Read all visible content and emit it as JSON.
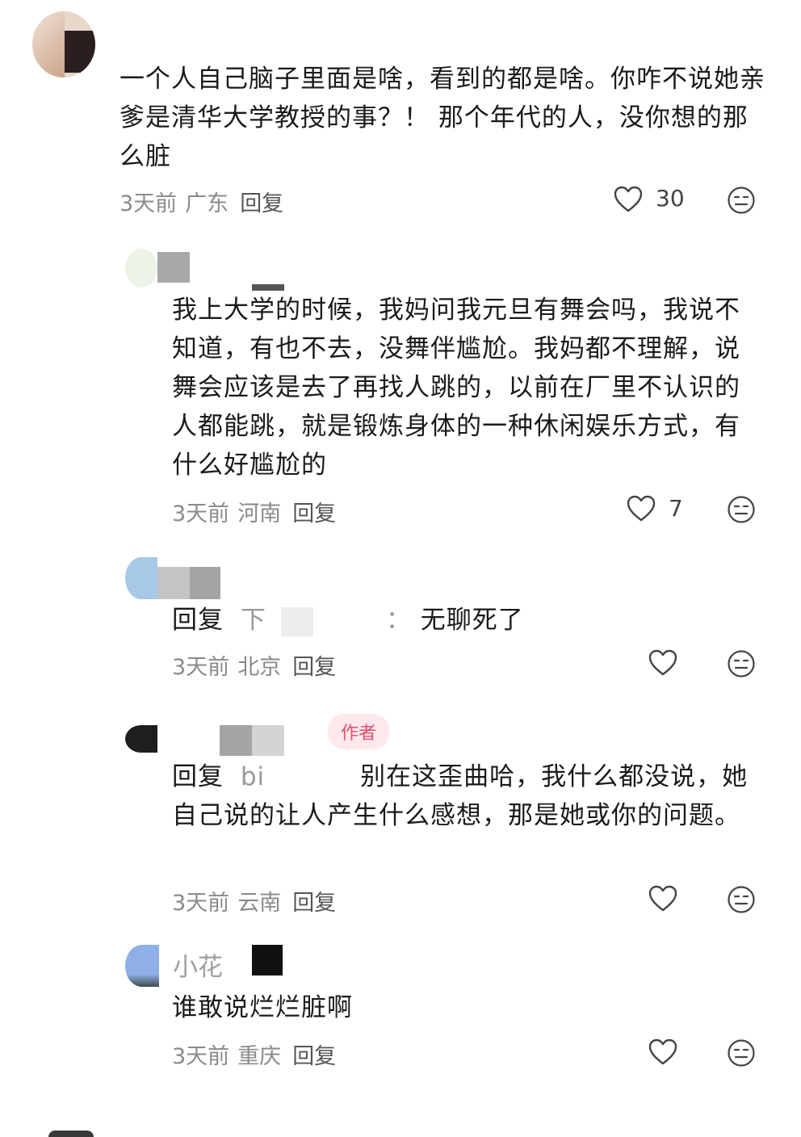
{
  "comments": [
    {
      "text": "一个人自己脑子里面是啥，看到的都是啥。你咋不说她亲爹是清华大学教授的事？！ 那个年代的人，没你想的那么脏",
      "time": "3天前",
      "location": "广东",
      "reply_label": "回复",
      "likes": "30"
    },
    {
      "text": "我上大学的时候，我妈问我元旦有舞会吗，我说不知道，有也不去，没舞伴尴尬。我妈都不理解，说舞会应该是去了再找人跳的，以前在厂里不认识的人都能跳，就是锻炼身体的一种休闲娱乐方式，有什么好尴尬的",
      "time": "3天前",
      "location": "河南",
      "reply_label": "回复",
      "likes": "7"
    },
    {
      "reply_prefix": "回复",
      "mention_fragment": "下",
      "mention_tail": "：",
      "text": "无聊死了",
      "time": "3天前",
      "location": "北京",
      "reply_label": "回复"
    },
    {
      "author_badge": "作者",
      "reply_prefix": "回复",
      "mention_fragment": "bi",
      "text": "别在这歪曲哈，我什么都没说，她自己说的让人产生什么感想，那是她或你的问题。",
      "time": "3天前",
      "location": "云南",
      "reply_label": "回复"
    },
    {
      "username_fragment": "小花",
      "text": "谁敢说烂烂脏啊",
      "time": "3天前",
      "location": "重庆",
      "reply_label": "回复"
    }
  ],
  "icons": {
    "like": "heart-outline-icon",
    "emoji": "neutral-face-icon"
  },
  "colors": {
    "badge_bg": "#fde9ec",
    "badge_text": "#e0506e",
    "meta": "#8a8a8a"
  }
}
